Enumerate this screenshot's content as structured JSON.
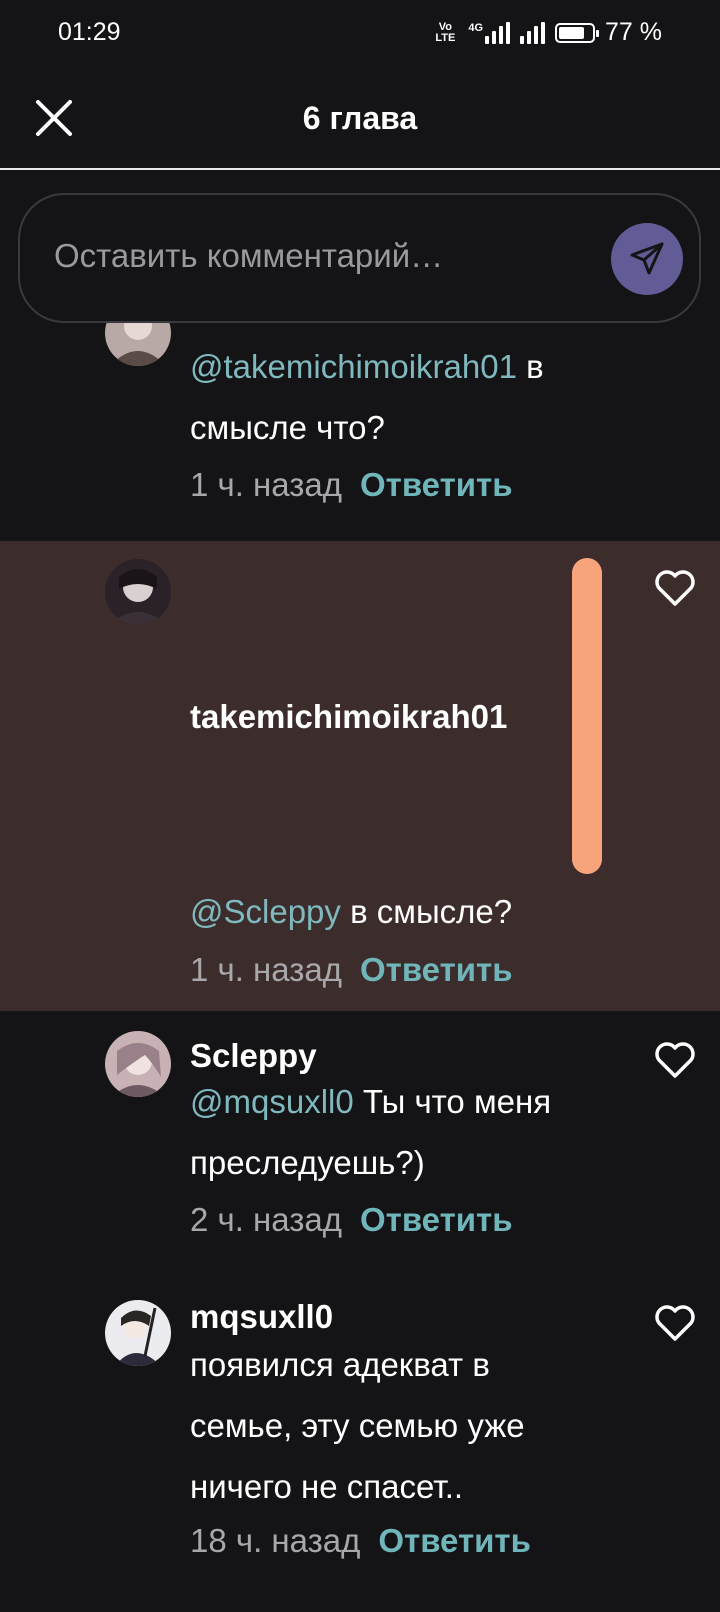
{
  "status_bar": {
    "time": "01:29",
    "volte_top": "Vo",
    "volte_bottom": "LTE",
    "network": "4G",
    "battery_text": "77 %",
    "battery_level": 0.77
  },
  "header": {
    "title": "6 глава",
    "close_icon": "close-icon"
  },
  "comment_bar": {
    "placeholder": "Оставить комментарий…",
    "send_icon": "send-icon"
  },
  "comments": [
    {
      "author": "",
      "mention": "@takemichimoikrah01",
      "text": " в смысле что?",
      "time": "1 ч. назад",
      "reply_label": "Ответить"
    },
    {
      "author": "takemichimoikrah01",
      "mention": "@Scleppy",
      "text": " в смысле?",
      "time": "1 ч. назад",
      "reply_label": "Ответить",
      "highlighted": true
    },
    {
      "author": "Scleppy",
      "mention": "@mqsuxll0",
      "text": " Ты что меня преследуешь?)",
      "time": "2 ч. назад",
      "reply_label": "Ответить"
    },
    {
      "author": "mqsuxll0",
      "mention": "",
      "text": "появился адекват в семье, эту семью уже ничего не спасет..",
      "time": "18 ч. назад",
      "reply_label": "Ответить"
    }
  ],
  "colors": {
    "background": "#141316",
    "highlight": "#3c2d2c",
    "mention": "#7fb8bd",
    "reply": "#6fb5b9",
    "send_button": "#625c96",
    "scrollbar": "#f7a47b"
  }
}
